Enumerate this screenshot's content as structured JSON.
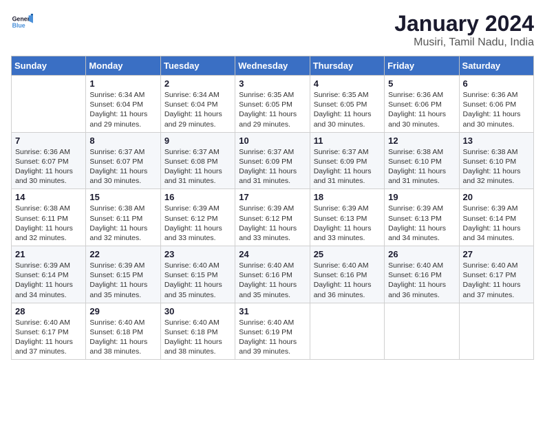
{
  "logo": {
    "line1": "General",
    "line2": "Blue"
  },
  "title": "January 2024",
  "subtitle": "Musiri, Tamil Nadu, India",
  "days_of_week": [
    "Sunday",
    "Monday",
    "Tuesday",
    "Wednesday",
    "Thursday",
    "Friday",
    "Saturday"
  ],
  "weeks": [
    [
      {
        "num": "",
        "info": ""
      },
      {
        "num": "1",
        "info": "Sunrise: 6:34 AM\nSunset: 6:04 PM\nDaylight: 11 hours\nand 29 minutes."
      },
      {
        "num": "2",
        "info": "Sunrise: 6:34 AM\nSunset: 6:04 PM\nDaylight: 11 hours\nand 29 minutes."
      },
      {
        "num": "3",
        "info": "Sunrise: 6:35 AM\nSunset: 6:05 PM\nDaylight: 11 hours\nand 29 minutes."
      },
      {
        "num": "4",
        "info": "Sunrise: 6:35 AM\nSunset: 6:05 PM\nDaylight: 11 hours\nand 30 minutes."
      },
      {
        "num": "5",
        "info": "Sunrise: 6:36 AM\nSunset: 6:06 PM\nDaylight: 11 hours\nand 30 minutes."
      },
      {
        "num": "6",
        "info": "Sunrise: 6:36 AM\nSunset: 6:06 PM\nDaylight: 11 hours\nand 30 minutes."
      }
    ],
    [
      {
        "num": "7",
        "info": "Sunrise: 6:36 AM\nSunset: 6:07 PM\nDaylight: 11 hours\nand 30 minutes."
      },
      {
        "num": "8",
        "info": "Sunrise: 6:37 AM\nSunset: 6:07 PM\nDaylight: 11 hours\nand 30 minutes."
      },
      {
        "num": "9",
        "info": "Sunrise: 6:37 AM\nSunset: 6:08 PM\nDaylight: 11 hours\nand 31 minutes."
      },
      {
        "num": "10",
        "info": "Sunrise: 6:37 AM\nSunset: 6:09 PM\nDaylight: 11 hours\nand 31 minutes."
      },
      {
        "num": "11",
        "info": "Sunrise: 6:37 AM\nSunset: 6:09 PM\nDaylight: 11 hours\nand 31 minutes."
      },
      {
        "num": "12",
        "info": "Sunrise: 6:38 AM\nSunset: 6:10 PM\nDaylight: 11 hours\nand 31 minutes."
      },
      {
        "num": "13",
        "info": "Sunrise: 6:38 AM\nSunset: 6:10 PM\nDaylight: 11 hours\nand 32 minutes."
      }
    ],
    [
      {
        "num": "14",
        "info": "Sunrise: 6:38 AM\nSunset: 6:11 PM\nDaylight: 11 hours\nand 32 minutes."
      },
      {
        "num": "15",
        "info": "Sunrise: 6:38 AM\nSunset: 6:11 PM\nDaylight: 11 hours\nand 32 minutes."
      },
      {
        "num": "16",
        "info": "Sunrise: 6:39 AM\nSunset: 6:12 PM\nDaylight: 11 hours\nand 33 minutes."
      },
      {
        "num": "17",
        "info": "Sunrise: 6:39 AM\nSunset: 6:12 PM\nDaylight: 11 hours\nand 33 minutes."
      },
      {
        "num": "18",
        "info": "Sunrise: 6:39 AM\nSunset: 6:13 PM\nDaylight: 11 hours\nand 33 minutes."
      },
      {
        "num": "19",
        "info": "Sunrise: 6:39 AM\nSunset: 6:13 PM\nDaylight: 11 hours\nand 34 minutes."
      },
      {
        "num": "20",
        "info": "Sunrise: 6:39 AM\nSunset: 6:14 PM\nDaylight: 11 hours\nand 34 minutes."
      }
    ],
    [
      {
        "num": "21",
        "info": "Sunrise: 6:39 AM\nSunset: 6:14 PM\nDaylight: 11 hours\nand 34 minutes."
      },
      {
        "num": "22",
        "info": "Sunrise: 6:39 AM\nSunset: 6:15 PM\nDaylight: 11 hours\nand 35 minutes."
      },
      {
        "num": "23",
        "info": "Sunrise: 6:40 AM\nSunset: 6:15 PM\nDaylight: 11 hours\nand 35 minutes."
      },
      {
        "num": "24",
        "info": "Sunrise: 6:40 AM\nSunset: 6:16 PM\nDaylight: 11 hours\nand 35 minutes."
      },
      {
        "num": "25",
        "info": "Sunrise: 6:40 AM\nSunset: 6:16 PM\nDaylight: 11 hours\nand 36 minutes."
      },
      {
        "num": "26",
        "info": "Sunrise: 6:40 AM\nSunset: 6:16 PM\nDaylight: 11 hours\nand 36 minutes."
      },
      {
        "num": "27",
        "info": "Sunrise: 6:40 AM\nSunset: 6:17 PM\nDaylight: 11 hours\nand 37 minutes."
      }
    ],
    [
      {
        "num": "28",
        "info": "Sunrise: 6:40 AM\nSunset: 6:17 PM\nDaylight: 11 hours\nand 37 minutes."
      },
      {
        "num": "29",
        "info": "Sunrise: 6:40 AM\nSunset: 6:18 PM\nDaylight: 11 hours\nand 38 minutes."
      },
      {
        "num": "30",
        "info": "Sunrise: 6:40 AM\nSunset: 6:18 PM\nDaylight: 11 hours\nand 38 minutes."
      },
      {
        "num": "31",
        "info": "Sunrise: 6:40 AM\nSunset: 6:19 PM\nDaylight: 11 hours\nand 39 minutes."
      },
      {
        "num": "",
        "info": ""
      },
      {
        "num": "",
        "info": ""
      },
      {
        "num": "",
        "info": ""
      }
    ]
  ]
}
